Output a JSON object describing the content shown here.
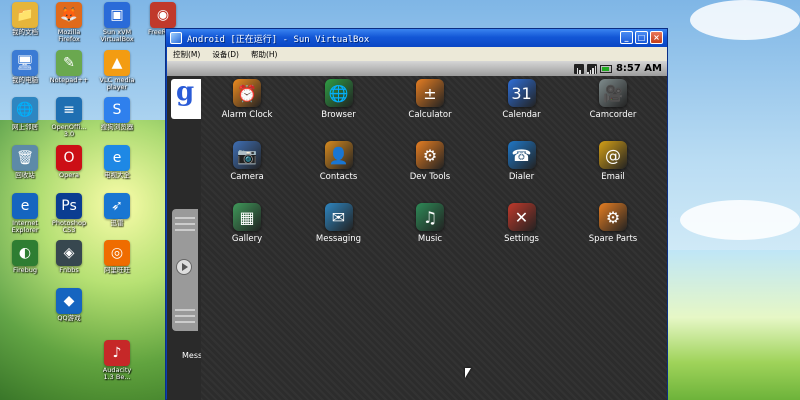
{
  "desktop": {
    "icons": [
      {
        "label": "我的文档",
        "glyph": "📁",
        "color": "#e6b53a",
        "icon": "documents-folder-icon"
      },
      {
        "label": "Mozilla\nFirefox",
        "glyph": "🦊",
        "color": "#e06a1b",
        "icon": "firefox-icon"
      },
      {
        "label": "Sun xVM\nVirtualBox",
        "glyph": "▣",
        "color": "#2a6bd8",
        "icon": "virtualbox-icon"
      },
      {
        "label": "FreeRM...",
        "glyph": "◉",
        "color": "#c0392b",
        "icon": "freerm-icon"
      },
      {
        "label": "我的电脑",
        "glyph": "🖥",
        "color": "#3b7bd4",
        "icon": "my-computer-icon"
      },
      {
        "label": "Notepad++",
        "glyph": "✎",
        "color": "#6aa84f",
        "icon": "notepadpp-icon"
      },
      {
        "label": "VLC media\nplayer",
        "glyph": "▲",
        "color": "#f39c12",
        "icon": "vlc-icon"
      },
      {
        "label": "网上邻居",
        "glyph": "🌐",
        "color": "#2e86c1",
        "icon": "network-icon"
      },
      {
        "label": "OpenOffi...\n3.0",
        "glyph": "≡",
        "color": "#1f6fb2",
        "icon": "openoffice-icon"
      },
      {
        "label": "搜狗浏览器",
        "glyph": "S",
        "color": "#2f80ed",
        "icon": "sogou-browser-icon"
      },
      {
        "label": "回收站",
        "glyph": "🗑",
        "color": "#5d8aa8",
        "icon": "recycle-bin-icon"
      },
      {
        "label": "Opera",
        "glyph": "O",
        "color": "#cc0f16",
        "icon": "opera-icon"
      },
      {
        "label": "电视大全",
        "glyph": "e",
        "color": "#1e88e5",
        "icon": "tv-icon"
      },
      {
        "label": "Internet\nExplorer",
        "glyph": "e",
        "color": "#1565c0",
        "icon": "ie-icon"
      },
      {
        "label": "Photoshop\nCS3",
        "glyph": "Ps",
        "color": "#0b3d91",
        "icon": "photoshop-icon"
      },
      {
        "label": "迅雷",
        "glyph": "➶",
        "color": "#1976d2",
        "icon": "thunder-icon"
      },
      {
        "label": "Firebug",
        "glyph": "◐",
        "color": "#2e7d32",
        "icon": "app-icon"
      },
      {
        "label": "Fnbbs",
        "glyph": "◈",
        "color": "#37474f",
        "icon": "app-icon"
      },
      {
        "label": "阿里旺旺",
        "glyph": "◎",
        "color": "#ef6c00",
        "icon": "aliwangwang-icon"
      },
      {
        "label": "QQ游戏",
        "glyph": "◆",
        "color": "#1565c0",
        "icon": "qq-game-icon"
      },
      {
        "label": "Audacity\n1.3 Be...",
        "glyph": "♪",
        "color": "#c62828",
        "icon": "audacity-icon"
      }
    ]
  },
  "window": {
    "title": "Android [正在运行] - Sun VirtualBox",
    "menu": [
      "控制(M)",
      "设备(D)",
      "帮助(H)"
    ],
    "minimize": "_",
    "maximize": "□",
    "close": "×"
  },
  "android": {
    "clock": "8:57 AM",
    "google_letter": "g",
    "peek_label": "Mess",
    "apps": [
      {
        "name": "Alarm Clock",
        "glyph": "⏰",
        "color": "#f08c1f",
        "icon": "alarm-clock-icon"
      },
      {
        "name": "Browser",
        "glyph": "🌐",
        "color": "#2f9e44",
        "icon": "browser-icon"
      },
      {
        "name": "Calculator",
        "glyph": "±",
        "color": "#e67e22",
        "icon": "calculator-icon"
      },
      {
        "name": "Calendar",
        "glyph": "31",
        "color": "#2f6fd8",
        "icon": "calendar-icon"
      },
      {
        "name": "Camcorder",
        "glyph": "🎥",
        "color": "#7f8c8d",
        "icon": "camcorder-icon"
      },
      {
        "name": "Camera",
        "glyph": "📷",
        "color": "#3f6fb5",
        "icon": "camera-icon"
      },
      {
        "name": "Contacts",
        "glyph": "👤",
        "color": "#d68a1f",
        "icon": "contacts-icon"
      },
      {
        "name": "Dev Tools",
        "glyph": "⚙",
        "color": "#e67e22",
        "icon": "dev-tools-icon"
      },
      {
        "name": "Dialer",
        "glyph": "☎",
        "color": "#1f78c8",
        "icon": "dialer-icon"
      },
      {
        "name": "Email",
        "glyph": "@",
        "color": "#d4a017",
        "icon": "email-icon"
      },
      {
        "name": "Gallery",
        "glyph": "▦",
        "color": "#3f9a5a",
        "icon": "gallery-icon"
      },
      {
        "name": "Messaging",
        "glyph": "✉",
        "color": "#2e86c1",
        "icon": "messaging-icon"
      },
      {
        "name": "Music",
        "glyph": "♫",
        "color": "#2e8b57",
        "icon": "music-icon"
      },
      {
        "name": "Settings",
        "glyph": "✕",
        "color": "#c0392b",
        "icon": "settings-icon"
      },
      {
        "name": "Spare Parts",
        "glyph": "⚙",
        "color": "#e67e22",
        "icon": "spare-parts-icon"
      }
    ]
  }
}
